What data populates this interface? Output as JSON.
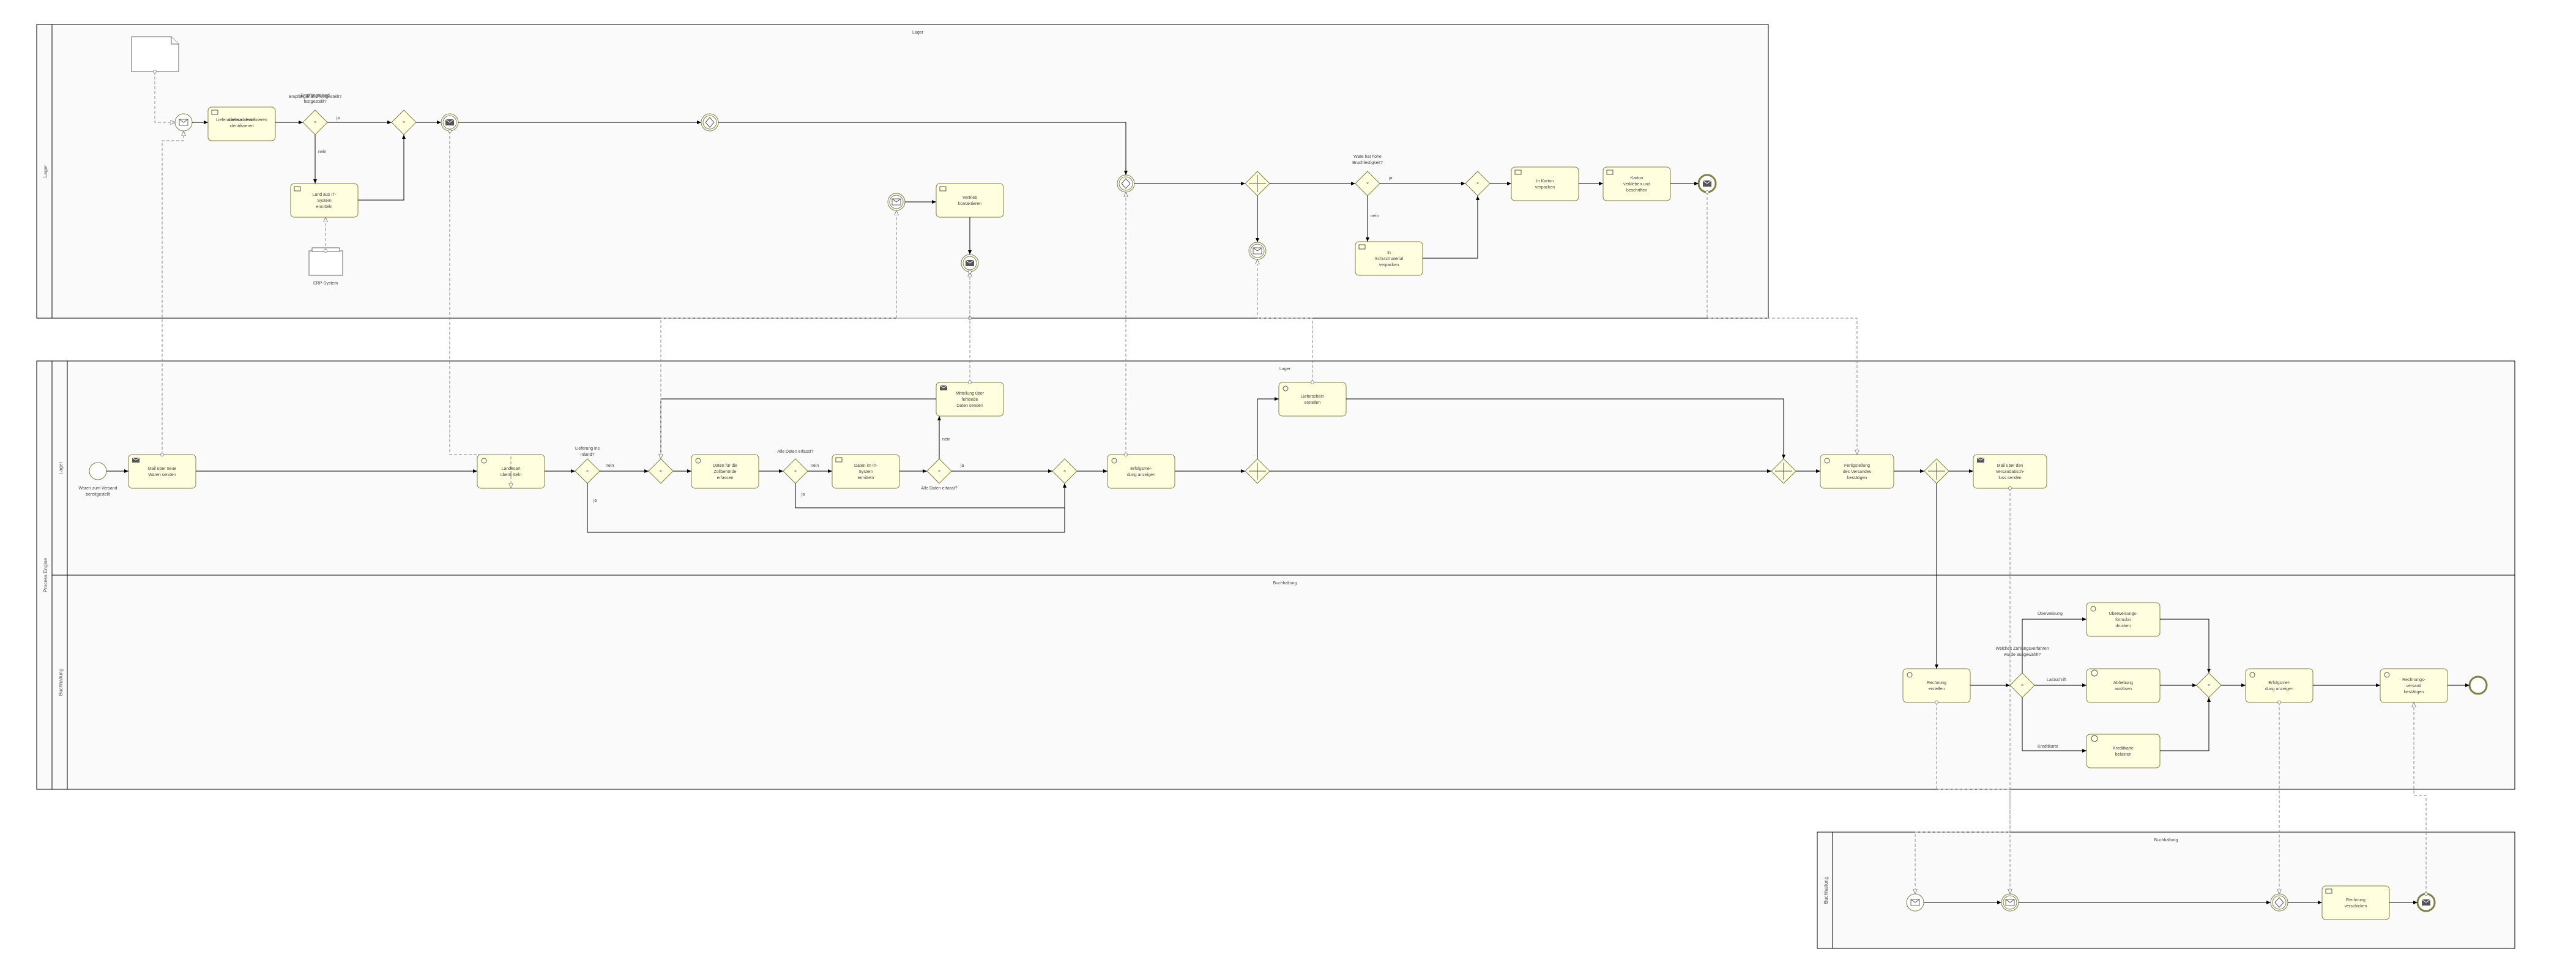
{
  "pools": {
    "p1": {
      "name": "Lager",
      "watermark": "Lager"
    },
    "p2": {
      "name": "Process Engine",
      "lanes": [
        "Lager",
        "Buchhaltung"
      ],
      "watermark_a": "Lager",
      "watermark_b": "Buchhaltung"
    },
    "p3": {
      "name": "Buchhaltung",
      "watermark": "Buchhaltung"
    }
  },
  "artifacts": {
    "doc1": "Kommissionier-\nliste",
    "ds1": "ERP-System"
  },
  "tasks": {
    "t_lieferadr": "Lieferadresse\nidentifizieren",
    "t_landit": "Land aus IT-\nSystem\nermitteln",
    "t_vertrieb": "Vertrieb\nkontaktieren",
    "t_schutz": "In\nSchutzmaterial\nverpacken",
    "t_karton": "In Karton\nverpacken",
    "t_verkl": "Karton\nverkleben und\nbeschriften",
    "t_mailneu": "Mail über neue\nWaren senden",
    "t_landesart": "Landesart\nübermitteln",
    "t_zoll": "Daten für die\nZollbehörde\nerfassen",
    "t_itdaten": "Daten im IT-\nSystem\nermitteln",
    "t_mitt": "Mitteilung über\nfehlende\nDaten senden",
    "t_erfmel": "Erfolgsmel-\ndung anzeigen",
    "t_lschein": "Lieferschein\nerstellen",
    "t_fertig": "Fertigstellung\ndes Versandes\nbestätigen",
    "t_mailabsch": "Mail über den\nVersandabsch-\nluss senden",
    "t_rechner": "Rechnung\nerstellen",
    "t_ueberw": "Überweisungs-\nformular\ndrucken",
    "t_abh": "Abhebung\nauslösen",
    "t_kk": "Kreditkarte\nbelasten",
    "t_erfmel2": "Erfolgsmel-\ndung anzeigen",
    "t_rvb": "Rechnungs-\nversand\nbestätigen",
    "t_rversch": "Rechnung\nverschicken"
  },
  "gw_labels": {
    "g_empf": "Empfängerland\nfestgestellt?",
    "g_liefins": "Lieferung ins\nInland?",
    "g_allerf": "Alle Daten erfasst?",
    "g_allerf2": "Alle Daten erfasst?",
    "g_bruch": "Ware hat hohe\nBruchfestigkeit?",
    "g_zv": "Welches Zahlungsverfahren\nwurde ausgewählt?"
  },
  "edge_labels": {
    "ja": "ja",
    "nein": "nein",
    "ueberw": "Überweisung",
    "last": "Lastschrift",
    "kk": "Kreditkarte"
  },
  "events": {
    "start_p2": "Waren zum Versand\nbereitgestellt"
  },
  "chart_data": {
    "type": "bpmn",
    "pools": [
      {
        "id": "Lager",
        "lanes": [
          "Lager"
        ]
      },
      {
        "id": "Process Engine",
        "lanes": [
          "Lager",
          "Buchhaltung"
        ]
      },
      {
        "id": "Buchhaltung-extern",
        "lanes": [
          "Buchhaltung"
        ]
      }
    ],
    "elements": [
      {
        "id": "doc_komm",
        "type": "data-object",
        "label": "Kommissionierliste",
        "pool": "Lager"
      },
      {
        "id": "erp",
        "type": "data-store",
        "label": "ERP-System",
        "pool": "Lager"
      },
      {
        "id": "e1",
        "type": "start-message",
        "pool": "Lager"
      },
      {
        "id": "a_lieferadr",
        "type": "user-task",
        "label": "Lieferadresse identifizieren",
        "pool": "Lager"
      },
      {
        "id": "g_empf",
        "type": "exclusive-gateway",
        "label": "Empfängerland festgestellt?",
        "pool": "Lager"
      },
      {
        "id": "a_landit",
        "type": "user-task",
        "label": "Land aus IT-System ermitteln",
        "pool": "Lager"
      },
      {
        "id": "g_merge1",
        "type": "exclusive-gateway",
        "pool": "Lager"
      },
      {
        "id": "e_send1",
        "type": "intermediate-throw-message",
        "pool": "Lager"
      },
      {
        "id": "e_catch_link",
        "type": "intermediate-catch",
        "pool": "Lager",
        "note": "link/multiple"
      },
      {
        "id": "e_recv_miss",
        "type": "intermediate-catch-message",
        "pool": "Lager"
      },
      {
        "id": "a_vertrieb",
        "type": "user-task",
        "label": "Vertrieb kontaktieren",
        "pool": "Lager"
      },
      {
        "id": "e_send_v",
        "type": "intermediate-throw-message",
        "pool": "Lager"
      },
      {
        "id": "e_catch2",
        "type": "intermediate-catch",
        "pool": "Lager"
      },
      {
        "id": "g_par_split",
        "type": "parallel-gateway",
        "pool": "Lager"
      },
      {
        "id": "e_recv_ls",
        "type": "intermediate-catch-message",
        "pool": "Lager"
      },
      {
        "id": "g_bruch",
        "type": "exclusive-gateway",
        "label": "Ware hat hohe Bruchfestigkeit?",
        "pool": "Lager"
      },
      {
        "id": "a_schutz",
        "type": "user-task",
        "label": "In Schutzmaterial verpacken",
        "pool": "Lager"
      },
      {
        "id": "g_merge_bruch",
        "type": "exclusive-gateway",
        "pool": "Lager"
      },
      {
        "id": "a_karton",
        "type": "user-task",
        "label": "In Karton verpacken",
        "pool": "Lager"
      },
      {
        "id": "a_verkl",
        "type": "user-task",
        "label": "Karton verkleben und beschriften",
        "pool": "Lager"
      },
      {
        "id": "e_end_lager",
        "type": "end-message",
        "pool": "Lager"
      },
      {
        "id": "e_start2",
        "type": "start-event",
        "label": "Waren zum Versand bereitgestellt",
        "pool": "Process Engine",
        "lane": "Lager"
      },
      {
        "id": "a_mailneu",
        "type": "send-task",
        "label": "Mail über neue Waren senden",
        "pool": "Process Engine",
        "lane": "Lager"
      },
      {
        "id": "a_landesart",
        "type": "user-task",
        "label": "Landesart übermitteln",
        "pool": "Process Engine",
        "lane": "Lager"
      },
      {
        "id": "g_liefins",
        "type": "exclusive-gateway",
        "label": "Lieferung ins Inland?",
        "pool": "Process Engine",
        "lane": "Lager"
      },
      {
        "id": "g_loop",
        "type": "exclusive-gateway",
        "pool": "Process Engine",
        "lane": "Lager"
      },
      {
        "id": "a_zoll",
        "type": "user-task",
        "label": "Daten für die Zollbehörde erfassen",
        "pool": "Process Engine",
        "lane": "Lager"
      },
      {
        "id": "g_allerf",
        "type": "exclusive-gateway",
        "label": "Alle Daten erfasst?",
        "pool": "Process Engine",
        "lane": "Lager"
      },
      {
        "id": "a_itdaten",
        "type": "business-rule-task",
        "label": "Daten im IT-System ermitteln",
        "pool": "Process Engine",
        "lane": "Lager"
      },
      {
        "id": "g_allerf2",
        "type": "exclusive-gateway",
        "label": "Alle Daten erfasst?",
        "pool": "Process Engine",
        "lane": "Lager"
      },
      {
        "id": "a_mitt",
        "type": "send-task",
        "label": "Mitteilung über fehlende Daten senden",
        "pool": "Process Engine",
        "lane": "Lager"
      },
      {
        "id": "g_merge2",
        "type": "exclusive-gateway",
        "pool": "Process Engine",
        "lane": "Lager"
      },
      {
        "id": "a_erfmel",
        "type": "user-task",
        "label": "Erfolgsmeldung anzeigen",
        "pool": "Process Engine",
        "lane": "Lager"
      },
      {
        "id": "g_par2",
        "type": "parallel-gateway",
        "pool": "Process Engine",
        "lane": "Lager"
      },
      {
        "id": "a_lschein",
        "type": "user-task",
        "label": "Lieferschein erstellen",
        "pool": "Process Engine",
        "lane": "Lager"
      },
      {
        "id": "g_par2_join",
        "type": "parallel-gateway",
        "pool": "Process Engine",
        "lane": "Lager"
      },
      {
        "id": "a_fertig",
        "type": "user-task",
        "label": "Fertigstellung des Versandes bestätigen",
        "pool": "Process Engine",
        "lane": "Lager"
      },
      {
        "id": "g_par3",
        "type": "parallel-gateway",
        "pool": "Process Engine",
        "lane": "Lager"
      },
      {
        "id": "a_mailabsch",
        "type": "send-task",
        "label": "Mail über den Versandabschluss senden",
        "pool": "Process Engine",
        "lane": "Lager"
      },
      {
        "id": "a_rechner",
        "type": "user-task",
        "label": "Rechnung erstellen",
        "pool": "Process Engine",
        "lane": "Buchhaltung"
      },
      {
        "id": "g_zv",
        "type": "exclusive-gateway",
        "label": "Welches Zahlungsverfahren wurde ausgewählt?",
        "pool": "Process Engine",
        "lane": "Buchhaltung"
      },
      {
        "id": "a_ueberw",
        "type": "user-task",
        "label": "Überweisungsformular drucken",
        "pool": "Process Engine",
        "lane": "Buchhaltung"
      },
      {
        "id": "a_abh",
        "type": "service-task",
        "label": "Abhebung auslösen",
        "pool": "Process Engine",
        "lane": "Buchhaltung"
      },
      {
        "id": "a_kk",
        "type": "service-task",
        "label": "Kreditkarte belasten",
        "pool": "Process Engine",
        "lane": "Buchhaltung"
      },
      {
        "id": "g_zv_merge",
        "type": "exclusive-gateway",
        "pool": "Process Engine",
        "lane": "Buchhaltung"
      },
      {
        "id": "a_erfmel2",
        "type": "user-task",
        "label": "Erfolgsmeldung anzeigen",
        "pool": "Process Engine",
        "lane": "Buchhaltung"
      },
      {
        "id": "a_rvb",
        "type": "user-task",
        "label": "Rechnungsversand bestätigen",
        "pool": "Process Engine",
        "lane": "Buchhaltung"
      },
      {
        "id": "e_end2",
        "type": "end-event",
        "pool": "Process Engine",
        "lane": "Buchhaltung"
      },
      {
        "id": "e_start3",
        "type": "start-message",
        "pool": "Buchhaltung-extern"
      },
      {
        "id": "e_recv3a",
        "type": "intermediate-catch-message",
        "pool": "Buchhaltung-extern"
      },
      {
        "id": "e_catch3",
        "type": "intermediate-catch",
        "pool": "Buchhaltung-extern"
      },
      {
        "id": "a_rversch",
        "type": "user-task",
        "label": "Rechnung verschicken",
        "pool": "Buchhaltung-extern"
      },
      {
        "id": "e_end3",
        "type": "end-message",
        "pool": "Buchhaltung-extern"
      }
    ],
    "sequence_flows": [
      [
        "e1",
        "a_lieferadr"
      ],
      [
        "a_lieferadr",
        "g_empf"
      ],
      [
        "g_empf",
        "g_merge1",
        "ja"
      ],
      [
        "g_empf",
        "a_landit",
        "nein"
      ],
      [
        "a_landit",
        "g_merge1"
      ],
      [
        "g_merge1",
        "e_send1"
      ],
      [
        "e_send1",
        "e_catch_link"
      ],
      [
        "e_recv_miss",
        "a_vertrieb"
      ],
      [
        "a_vertrieb",
        "e_send_v"
      ],
      [
        "e_catch_link",
        "e_catch2"
      ],
      [
        "e_catch2",
        "g_par_split"
      ],
      [
        "g_par_split",
        "e_recv_ls"
      ],
      [
        "g_par_split",
        "g_bruch"
      ],
      [
        "g_bruch",
        "g_merge_bruch",
        "ja"
      ],
      [
        "g_bruch",
        "a_schutz",
        "nein"
      ],
      [
        "a_schutz",
        "g_merge_bruch"
      ],
      [
        "g_merge_bruch",
        "a_karton"
      ],
      [
        "a_karton",
        "a_verkl"
      ],
      [
        "a_verkl",
        "e_end_lager"
      ],
      [
        "e_start2",
        "a_mailneu"
      ],
      [
        "a_mailneu",
        "a_landesart"
      ],
      [
        "a_landesart",
        "g_liefins"
      ],
      [
        "g_liefins",
        "g_loop",
        "nein"
      ],
      [
        "g_loop",
        "a_zoll"
      ],
      [
        "a_zoll",
        "g_allerf"
      ],
      [
        "g_allerf",
        "a_itdaten",
        "nein"
      ],
      [
        "a_itdaten",
        "g_allerf2"
      ],
      [
        "g_allerf2",
        "a_mitt",
        "nein"
      ],
      [
        "a_mitt",
        "g_loop"
      ],
      [
        "g_allerf2",
        "g_merge2",
        "ja"
      ],
      [
        "g_allerf",
        "g_merge2",
        "ja"
      ],
      [
        "g_liefins",
        "g_merge2",
        "ja"
      ],
      [
        "g_merge2",
        "a_erfmel"
      ],
      [
        "a_erfmel",
        "g_par2"
      ],
      [
        "g_par2",
        "a_lschein"
      ],
      [
        "g_par2",
        "g_par2_join"
      ],
      [
        "a_lschein",
        "g_par2_join"
      ],
      [
        "g_par2_join",
        "a_fertig"
      ],
      [
        "a_fertig",
        "g_par3"
      ],
      [
        "g_par3",
        "a_mailabsch"
      ],
      [
        "g_par3",
        "a_rechner"
      ],
      [
        "a_rechner",
        "g_zv"
      ],
      [
        "g_zv",
        "a_ueberw",
        "Überweisung"
      ],
      [
        "g_zv",
        "a_abh",
        "Lastschrift"
      ],
      [
        "g_zv",
        "a_kk",
        "Kreditkarte"
      ],
      [
        "a_ueberw",
        "g_zv_merge"
      ],
      [
        "a_abh",
        "g_zv_merge"
      ],
      [
        "a_kk",
        "g_zv_merge"
      ],
      [
        "g_zv_merge",
        "a_erfmel2"
      ],
      [
        "a_erfmel2",
        "a_rvb"
      ],
      [
        "a_rvb",
        "e_end2"
      ],
      [
        "e_start3",
        "e_recv3a"
      ],
      [
        "e_recv3a",
        "e_catch3"
      ],
      [
        "e_catch3",
        "a_rversch"
      ],
      [
        "a_rversch",
        "e_end3"
      ]
    ],
    "message_flows": [
      [
        "a_mailneu",
        "e1"
      ],
      [
        "e_send1",
        "a_landesart"
      ],
      [
        "a_mitt",
        "e_recv_miss"
      ],
      [
        "e_send_v",
        "g_loop"
      ],
      [
        "a_erfmel",
        "e_catch2"
      ],
      [
        "a_lschein",
        "e_recv_ls"
      ],
      [
        "e_end_lager",
        "a_fertig"
      ],
      [
        "a_mailabsch",
        "e_start3"
      ],
      [
        "a_rechner",
        "e_recv3a"
      ],
      [
        "a_erfmel2",
        "e_catch3"
      ],
      [
        "e_end3",
        "a_rvb"
      ]
    ],
    "data_associations": [
      [
        "doc_komm",
        "a_lieferadr"
      ],
      [
        "erp",
        "a_landit"
      ]
    ]
  }
}
